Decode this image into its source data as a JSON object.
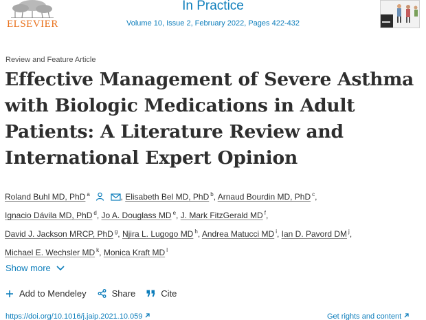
{
  "header": {
    "publisher": "ELSEVIER",
    "journal_title": "In Practice",
    "journal_meta": "Volume 10, Issue 2, February 2022, Pages 422-432"
  },
  "article": {
    "type": "Review and Feature Article",
    "title": "Effective Management of Severe Asthma with Biologic Medications in Adult Patients: A Literature Review and International Expert Opinion"
  },
  "authors": [
    {
      "name": "Roland Buhl MD, PhD",
      "sup": "a"
    },
    {
      "name": "Elisabeth Bel MD, PhD",
      "sup": "b"
    },
    {
      "name": "Arnaud Bourdin MD, PhD",
      "sup": "c"
    },
    {
      "name": "Ignacio Dávila MD, PhD",
      "sup": "d"
    },
    {
      "name": "Jo A. Douglass MD",
      "sup": "e"
    },
    {
      "name": "J. Mark FitzGerald MD",
      "sup": "f"
    },
    {
      "name": "David J. Jackson MRCP, PhD",
      "sup": "g"
    },
    {
      "name": "Njira L. Lugogo MD",
      "sup": "h"
    },
    {
      "name": "Andrea Matucci MD",
      "sup": "i"
    },
    {
      "name": "Ian D. Pavord DM",
      "sup": "j"
    },
    {
      "name": "Michael E. Wechsler MD",
      "sup": "k"
    },
    {
      "name": "Monica Kraft MD",
      "sup": "l"
    }
  ],
  "show_more": "Show more",
  "actions": {
    "add_mendeley": "Add to Mendeley",
    "share": "Share",
    "cite": "Cite"
  },
  "footer": {
    "doi": "https://doi.org/10.1016/j.jaip.2021.10.059",
    "rights": "Get rights and content"
  },
  "colors": {
    "accent": "#0c7dbb",
    "elsevier_orange": "#e9711c",
    "text": "#2e2e2e"
  },
  "icons": [
    "person-icon",
    "envelope-icon",
    "chevron-down-icon",
    "plus-icon",
    "share-icon",
    "quote-icon",
    "external-link-icon"
  ]
}
